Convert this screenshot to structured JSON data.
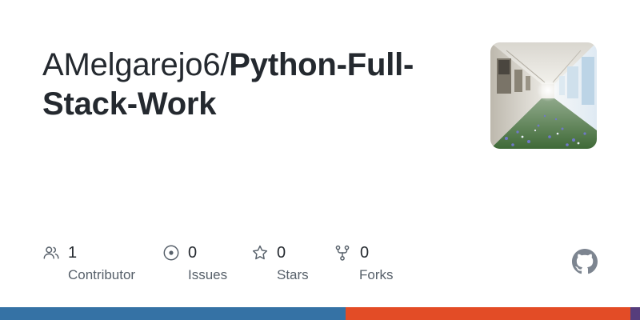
{
  "repo": {
    "owner": "AMelgarejo6/",
    "name_line1": "Python-Full-",
    "name_line2": "Stack-Work"
  },
  "stats": [
    {
      "icon": "people-icon",
      "count": "1",
      "label": "Contributor"
    },
    {
      "icon": "issue-icon",
      "count": "0",
      "label": "Issues"
    },
    {
      "icon": "star-icon",
      "count": "0",
      "label": "Stars"
    },
    {
      "icon": "fork-icon",
      "count": "0",
      "label": "Forks"
    }
  ],
  "avatar": {
    "icon": "repository-avatar-image"
  },
  "brand": {
    "icon": "github-logo-icon"
  },
  "colors": {
    "title": "#24292f",
    "muted": "#57606a",
    "lang_primary": "#3572A5",
    "lang_secondary": "#e34c26",
    "lang_tertiary": "#563d7c"
  },
  "languages": [
    {
      "color": "#3572A5",
      "fraction": 0.54
    },
    {
      "color": "#e34c26",
      "fraction": 0.445
    },
    {
      "color": "#563d7c",
      "fraction": 0.015
    }
  ]
}
